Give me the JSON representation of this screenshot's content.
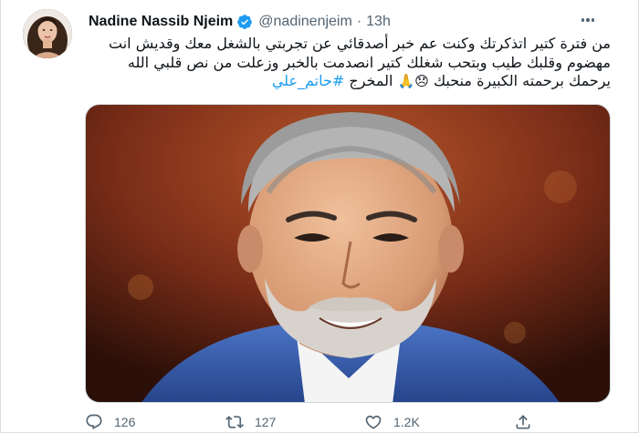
{
  "tweet": {
    "author_name": "Nadine Nassib Njeim",
    "handle": "@nadinenjeim",
    "separator": "·",
    "time": "13h",
    "text_lines": [
      "من فترة كتير اتذكرتك وكنت عم خبر أصدقائي عن تجربتي بالشغل معك وقديش انت",
      "مهضوم وقلبك طيب وبتحب شغلك كتير انصدمت بالخبر وزعلت من نص قلبي الله",
      "يرحمك برحمته الكبيرة منحبك"
    ],
    "line3_emojis": "😞🙏",
    "line3_suffix": "المخرج",
    "hashtag": "#حاتم_علي",
    "icons": {
      "avatar": "avatar-photo",
      "verified": "verified-badge-icon",
      "more": "more-options-icon",
      "reply": "reply-icon",
      "retweet": "retweet-icon",
      "like": "heart-icon",
      "share": "share-icon"
    },
    "stats": {
      "replies": "126",
      "retweets": "127",
      "likes": "1.2K"
    },
    "colors": {
      "accent": "#1d9bf0",
      "text": "#0f1419",
      "secondary": "#536471"
    }
  }
}
